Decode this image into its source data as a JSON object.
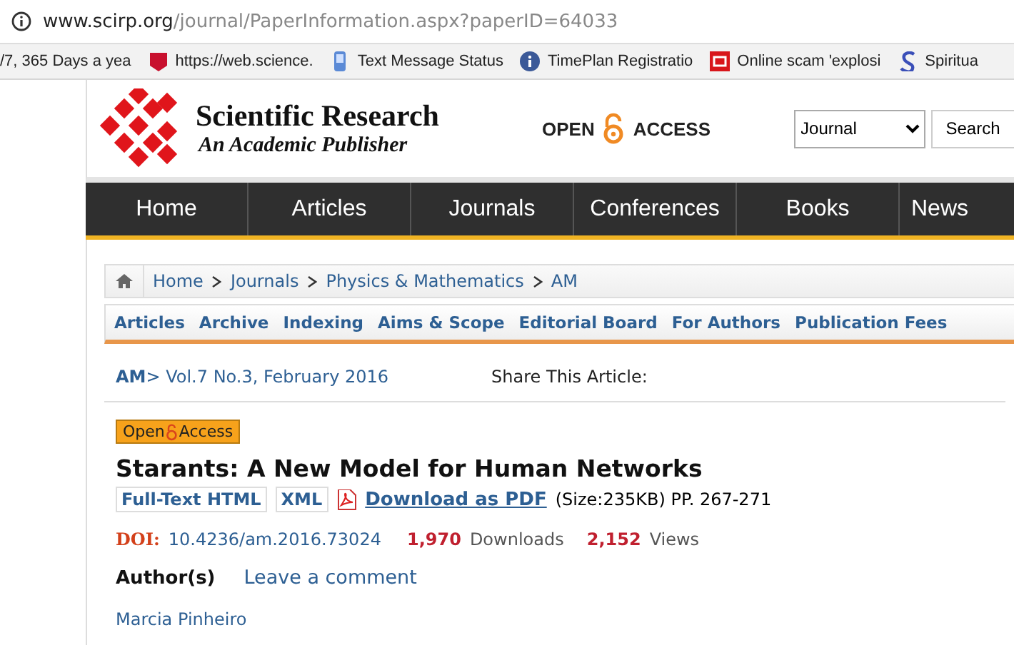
{
  "browser": {
    "url_host": "www.scirp.org",
    "url_path": "/journal/PaperInformation.aspx?paperID=64033",
    "bookmarks": [
      {
        "label": "/7, 365 Days a yea",
        "kind": "none"
      },
      {
        "label": "https://web.science.",
        "kind": "shield"
      },
      {
        "label": "Text Message Status",
        "kind": "phone"
      },
      {
        "label": "TimePlan Registratio",
        "kind": "info"
      },
      {
        "label": "Online scam 'explosi",
        "kind": "qt"
      },
      {
        "label": "Spiritua",
        "kind": "s"
      }
    ]
  },
  "header": {
    "brand": "Scientific Research",
    "tagline": "An Academic Publisher",
    "open": "OPEN",
    "access": "ACCESS",
    "search_type": "Journal",
    "search_button": "Search"
  },
  "nav": [
    {
      "label": "Home"
    },
    {
      "label": "Articles"
    },
    {
      "label": "Journals"
    },
    {
      "label": "Conferences"
    },
    {
      "label": "Books"
    },
    {
      "label": "News"
    }
  ],
  "breadcrumb": [
    "Home",
    "Journals",
    "Physics & Mathematics",
    "AM"
  ],
  "journal_menu": [
    "Articles",
    "Archive",
    "Indexing",
    "Aims & Scope",
    "Editorial Board",
    "For Authors",
    "Publication Fees"
  ],
  "article": {
    "journal": "AM",
    "issue": "> Vol.7 No.3, February 2016",
    "share": "Share This Article:",
    "badge_open": "Open",
    "badge_access": "Access",
    "title": "Starants: A New Model for Human Networks",
    "formats": [
      "Full-Text HTML",
      "XML"
    ],
    "pdf": "Download as PDF",
    "size": "(Size:235KB) PP. 267-271",
    "doi_label": "DOI:",
    "doi": "10.4236/am.2016.73024",
    "downloads": "1,970",
    "downloads_label": "Downloads",
    "views": "2,152",
    "views_label": "Views",
    "authors_label": "Author(s)",
    "comment": "Leave a comment",
    "author": "Marcia Pinheiro"
  }
}
